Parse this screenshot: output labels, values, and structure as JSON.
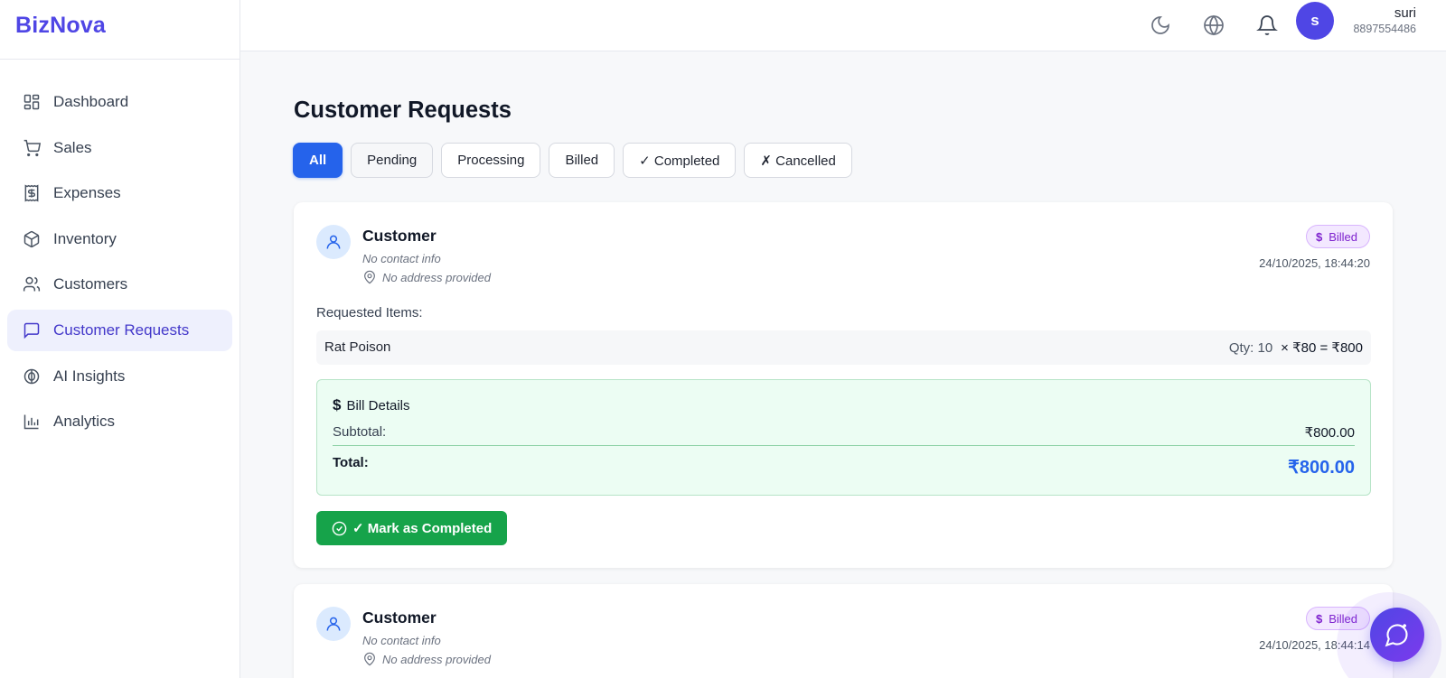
{
  "brand": {
    "name": "BizNova",
    "color": "#4f46e5"
  },
  "sidebar": {
    "items": [
      {
        "label": "Dashboard",
        "icon": "dashboard-icon"
      },
      {
        "label": "Sales",
        "icon": "cart-icon"
      },
      {
        "label": "Expenses",
        "icon": "receipt-icon"
      },
      {
        "label": "Inventory",
        "icon": "box-icon"
      },
      {
        "label": "Customers",
        "icon": "users-icon"
      },
      {
        "label": "Customer Requests",
        "icon": "message-icon",
        "active": true
      },
      {
        "label": "AI Insights",
        "icon": "brain-icon"
      },
      {
        "label": "Analytics",
        "icon": "bar-chart-icon"
      }
    ]
  },
  "topbar": {
    "icons": [
      "moon-icon",
      "globe-icon",
      "bell-icon"
    ],
    "user": {
      "initial": "s",
      "name": "suri",
      "phone": "8897554486"
    }
  },
  "main": {
    "title": "Customer Requests",
    "filters": [
      {
        "label": "All",
        "active": true
      },
      {
        "label": "Pending"
      },
      {
        "label": "Processing"
      },
      {
        "label": "Billed"
      },
      {
        "label": "✓ Completed"
      },
      {
        "label": "✗ Cancelled"
      }
    ],
    "requests": [
      {
        "customer": "Customer",
        "contact": "No contact info",
        "address": "No address provided",
        "status": "Billed",
        "timestamp": "24/10/2025, 18:44:20",
        "items_label": "Requested Items:",
        "items": [
          {
            "name": "Rat Poison",
            "qty": "Qty: 10",
            "price": "× ₹80 = ₹800"
          }
        ],
        "bill": {
          "title": "Bill Details",
          "subtotal_label": "Subtotal:",
          "subtotal": "₹800.00",
          "total_label": "Total:",
          "total": "₹800.00"
        },
        "action": "✓ Mark as Completed"
      },
      {
        "customer": "Customer",
        "contact": "No contact info",
        "address": "No address provided",
        "status": "Billed",
        "timestamp": "24/10/2025, 18:44:14"
      }
    ]
  },
  "colors": {
    "primary": "#2563eb",
    "success": "#16a34a",
    "billed_badge": "#7e22ce",
    "bill_bg": "#ecfdf3"
  }
}
